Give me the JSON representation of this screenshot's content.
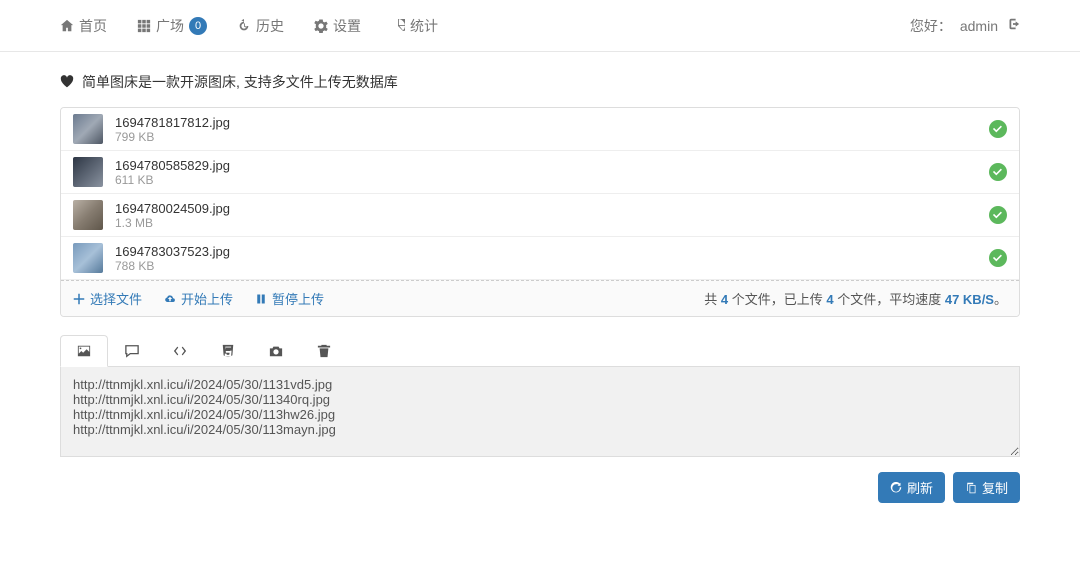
{
  "nav": {
    "home": "首页",
    "square": "广场",
    "square_badge": "0",
    "history": "历史",
    "settings": "设置",
    "stats": "统计"
  },
  "user": {
    "greeting": "您好：",
    "name": "admin"
  },
  "tagline": "简单图床是一款开源图床, 支持多文件上传无数据库",
  "files": [
    {
      "name": "1694781817812.jpg",
      "size": "799 KB"
    },
    {
      "name": "1694780585829.jpg",
      "size": "611 KB"
    },
    {
      "name": "1694780024509.jpg",
      "size": "1.3 MB"
    },
    {
      "name": "1694783037523.jpg",
      "size": "788 KB"
    }
  ],
  "toolbar": {
    "select": "选择文件",
    "start": "开始上传",
    "pause": "暂停上传"
  },
  "summary": {
    "p1": "共 ",
    "total": "4",
    "p2": " 个文件，已上传 ",
    "done": "4",
    "p3": " 个文件，平均速度 ",
    "speed": "47 KB/S",
    "p4": "。"
  },
  "urls": "http://ttnmjkl.xnl.icu/i/2024/05/30/1131vd5.jpg\nhttp://ttnmjkl.xnl.icu/i/2024/05/30/11340rq.jpg\nhttp://ttnmjkl.xnl.icu/i/2024/05/30/113hw26.jpg\nhttp://ttnmjkl.xnl.icu/i/2024/05/30/113mayn.jpg",
  "buttons": {
    "refresh": "刷新",
    "copy": "复制"
  }
}
